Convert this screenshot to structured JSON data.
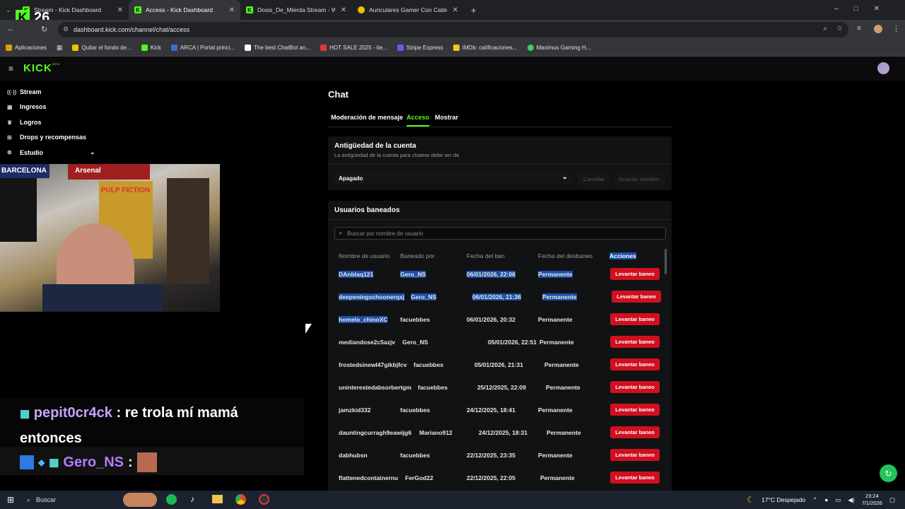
{
  "browser": {
    "tabs": [
      {
        "title": "Stream - Kick Dashboard"
      },
      {
        "title": "Access - Kick Dashboard"
      },
      {
        "title": "Dosis_De_Mierda Stream - Wat"
      },
      {
        "title": "Auriculares Gamer Con Cable H"
      }
    ],
    "url": "dashboard.kick.com/channel/chat/access",
    "overlay_number": "26",
    "bookmarks": [
      {
        "label": "Aplicaciones",
        "color": "#e0a000"
      },
      {
        "label": "Quitar el fondo de...",
        "color": "#f5c200"
      },
      {
        "label": "Kick",
        "color": "#53fc18"
      },
      {
        "label": "ARCA | Portal princi...",
        "color": "#3b6fc8"
      },
      {
        "label": "The best ChatBot an...",
        "color": "#ffffff"
      },
      {
        "label": "HOT SALE 2025 - tie...",
        "color": "#e03a3a"
      },
      {
        "label": "Stripe Express",
        "color": "#635bff"
      },
      {
        "label": "IMDb: calificaciones...",
        "color": "#f5c518"
      },
      {
        "label": "Maximus Gaming H...",
        "color": "#3bd16f"
      }
    ]
  },
  "kick": {
    "logo": "KICK",
    "logo_badge": "BETA"
  },
  "sidebar": {
    "items": [
      {
        "label": "Stream",
        "icon": "broadcast-icon"
      },
      {
        "label": "Ingresos",
        "icon": "wallet-icon"
      },
      {
        "label": "Logros",
        "icon": "trophy-icon"
      },
      {
        "label": "Drops y recompensas",
        "icon": "gift-icon"
      },
      {
        "label": "Estudio",
        "icon": "studio-icon"
      }
    ]
  },
  "webcam": {
    "posters": [
      "BARCELONA",
      "Arsenal",
      "PULP FICTION"
    ]
  },
  "chat_overlay": {
    "line1_user": "pepit0cr4ck",
    "line1_msg": ": re trola mí mamá entonces",
    "line2_user": "Gero_NS",
    "line2_sep": ":"
  },
  "page": {
    "title": "Chat",
    "tabs": [
      "Moderación de mensaje",
      "Acceso",
      "Mostrar"
    ],
    "active_tab": "Acceso"
  },
  "account_age": {
    "title": "Antigüedad de la cuenta",
    "desc": "La antigüedad de la cuenta para chatear debe ser de",
    "selected": "Apagado",
    "cancel": "Cancelar",
    "save": "Guardar cambios"
  },
  "banned": {
    "title": "Usuarios baneados",
    "search_placeholder": "Buscar por nombre de usuario",
    "columns": [
      "Nombre de usuario",
      "Baneado por",
      "Fecha del ban",
      "Fecha del desbaneo",
      "Acciones"
    ],
    "action_label": "Levantar baneo",
    "rows": [
      {
        "user": "DAnblaq121",
        "by": "Gero_NS",
        "date": "06/01/2026, 22:06",
        "unban": "Permanente",
        "hl": "full"
      },
      {
        "user": "deepeningschoonerqxj",
        "by": "Gero_NS",
        "date": "06/01/2026, 21:36",
        "unban": "Permanente",
        "hl": "full"
      },
      {
        "user": "homelo_chinoXC",
        "by": "facuebbes",
        "date": "06/01/2026, 20:32",
        "unban": "Permanente",
        "hl": "user"
      },
      {
        "user": "mediandose2c5azjv",
        "by": "Gero_NS",
        "date": "05/01/2026, 22:51",
        "unban": "Permanente",
        "hl": "none"
      },
      {
        "user": "frostedsinewl47gikbjfcv",
        "by": "facuebbes",
        "date": "05/01/2026, 21:31",
        "unban": "Permanente",
        "hl": "none"
      },
      {
        "user": "uninterestedabsorbertgm",
        "by": "facuebbes",
        "date": "25/12/2025, 22:09",
        "unban": "Permanente",
        "hl": "none"
      },
      {
        "user": "jamzkid332",
        "by": "facuebbes",
        "date": "24/12/2025, 18:41",
        "unban": "Permanente",
        "hl": "none"
      },
      {
        "user": "dauntingcurragh9eawijg6",
        "by": "Mariano912",
        "date": "24/12/2025, 18:31",
        "unban": "Permanente",
        "hl": "none"
      },
      {
        "user": "dabhubsn",
        "by": "facuebbes",
        "date": "22/12/2025, 23:35",
        "unban": "Permanente",
        "hl": "none"
      },
      {
        "user": "flattenedcontainernu",
        "by": "FerGod22",
        "date": "22/12/2025, 22:05",
        "unban": "Permanente",
        "hl": "none"
      }
    ]
  },
  "taskbar": {
    "search": "Buscar",
    "weather": "17°C  Despejado",
    "time": "23:24",
    "date": "7/1/2026"
  }
}
